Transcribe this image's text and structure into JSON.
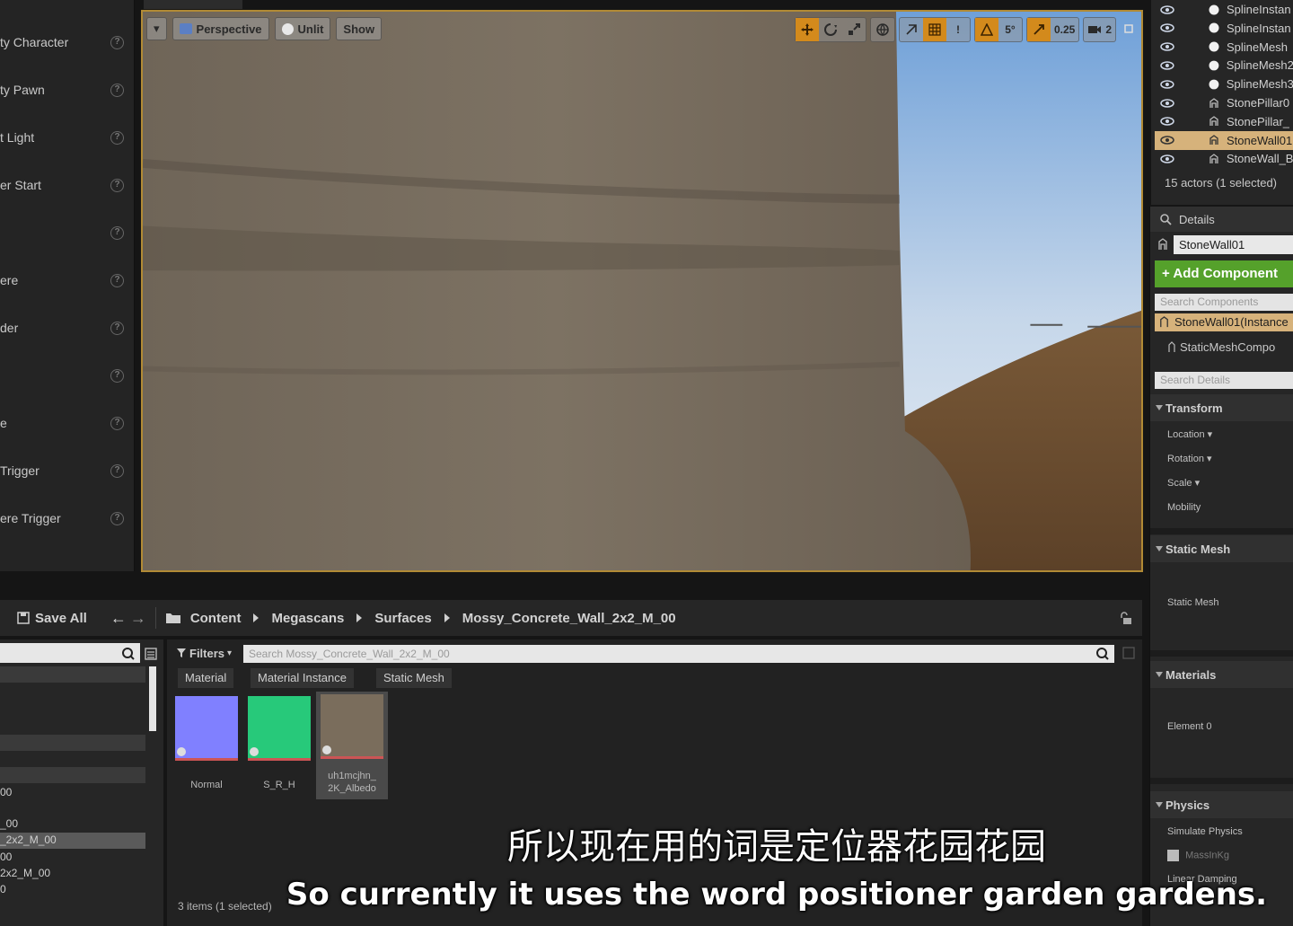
{
  "left_panel": {
    "items": [
      {
        "label": "ty Character"
      },
      {
        "label": "ty Pawn"
      },
      {
        "label": "t Light"
      },
      {
        "label": "er Start"
      },
      {
        "label": ""
      },
      {
        "label": "ere"
      },
      {
        "label": "der"
      },
      {
        "label": ""
      },
      {
        "label": "e"
      },
      {
        "label": "Trigger"
      },
      {
        "label": "ere Trigger"
      }
    ],
    "help_glyph": "?"
  },
  "viewport": {
    "perspective_label": "Perspective",
    "unlit_label": "Unlit",
    "show_label": "Show",
    "dropdown_glyph": "▾",
    "snap_angle": "5°",
    "snap_scale": "0.25",
    "camera_speed": "2",
    "warning_glyph": "!",
    "accent_color": "#d38a1c"
  },
  "outliner": {
    "rows": [
      {
        "label": "SplineInstan",
        "icon": "sphere-icon",
        "selected": false
      },
      {
        "label": "SplineInstan",
        "icon": "sphere-icon",
        "selected": false
      },
      {
        "label": "SplineMesh",
        "icon": "sphere-icon",
        "selected": false
      },
      {
        "label": "SplineMesh2",
        "icon": "sphere-icon",
        "selected": false
      },
      {
        "label": "SplineMesh3",
        "icon": "sphere-icon",
        "selected": false
      },
      {
        "label": "StonePillar0",
        "icon": "static-mesh-icon",
        "selected": false
      },
      {
        "label": "StonePillar_",
        "icon": "static-mesh-icon",
        "selected": false
      },
      {
        "label": "StoneWall01",
        "icon": "static-mesh-icon",
        "selected": true
      },
      {
        "label": "StoneWall_B",
        "icon": "static-mesh-icon",
        "selected": false
      }
    ],
    "summary": "15 actors (1 selected)"
  },
  "details": {
    "tab_label": "Details",
    "actor_name": "StoneWall01",
    "add_component_label": "+ Add Component",
    "search_components_placeholder": "Search Components",
    "component_instance": "StoneWall01(Instance",
    "sub_component": "StaticMeshCompo",
    "search_details_placeholder": "Search Details",
    "categories": {
      "transform": "Transform",
      "static_mesh": "Static Mesh",
      "materials": "Materials",
      "physics": "Physics"
    },
    "props": {
      "location": "Location",
      "rotation": "Rotation",
      "scale": "Scale",
      "mobility": "Mobility",
      "static_mesh": "Static Mesh",
      "element0": "Element 0",
      "simulate_physics": "Simulate Physics",
      "mass": "MassInKg",
      "linear_damping": "Linear Damping"
    }
  },
  "content_browser": {
    "save_all": "Save All",
    "breadcrumb": [
      "Content",
      "Megascans",
      "Surfaces",
      "Mossy_Concrete_Wall_2x2_M_00"
    ],
    "filters_label": "Filters",
    "search_placeholder": "Search Mossy_Concrete_Wall_2x2_M_00",
    "filter_chips": [
      "Material",
      "Material Instance",
      "Static Mesh"
    ],
    "assets": [
      {
        "name": "Normal",
        "color": "#8080ff"
      },
      {
        "name": "S_R_H",
        "color": "#27c97a"
      },
      {
        "name": "uh1mcjhn_ 2K_Albedo",
        "color": "#7a6d5c"
      }
    ],
    "status": "3 items (1 selected)",
    "left_tree": [
      "00",
      "_00",
      "_2x2_M_00",
      "00",
      "2x2_M_00",
      "0"
    ]
  },
  "subtitles": {
    "chinese": "所以现在用的词是定位器花园花园",
    "english": "So currently it uses the word positioner garden gardens."
  }
}
